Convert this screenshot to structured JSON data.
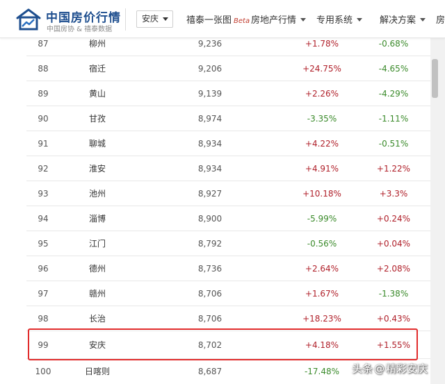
{
  "header": {
    "brand_title": "中国房价行情",
    "brand_subtitle": "中国房协 & 禧泰数据",
    "city_select": "安庆",
    "nav": [
      {
        "label": "禧泰一张图",
        "badge": "Beta"
      },
      {
        "label": "房地产行情"
      },
      {
        "label": "专用系统"
      },
      {
        "label": "解决方案"
      },
      {
        "label": "房"
      }
    ]
  },
  "table": {
    "rows": [
      {
        "rank": "87",
        "city": "柳州",
        "price": "9,236",
        "change1": "+1.78%",
        "change2": "-0.68%"
      },
      {
        "rank": "88",
        "city": "宿迁",
        "price": "9,206",
        "change1": "+24.75%",
        "change2": "-4.65%"
      },
      {
        "rank": "89",
        "city": "黄山",
        "price": "9,139",
        "change1": "+2.26%",
        "change2": "-4.29%"
      },
      {
        "rank": "90",
        "city": "甘孜",
        "price": "8,974",
        "change1": "-3.35%",
        "change2": "-1.11%"
      },
      {
        "rank": "91",
        "city": "聊城",
        "price": "8,934",
        "change1": "+4.22%",
        "change2": "-0.51%"
      },
      {
        "rank": "92",
        "city": "淮安",
        "price": "8,934",
        "change1": "+4.91%",
        "change2": "+1.22%"
      },
      {
        "rank": "93",
        "city": "池州",
        "price": "8,927",
        "change1": "+10.18%",
        "change2": "+3.3%"
      },
      {
        "rank": "94",
        "city": "淄博",
        "price": "8,900",
        "change1": "-5.99%",
        "change2": "+0.24%"
      },
      {
        "rank": "95",
        "city": "江门",
        "price": "8,792",
        "change1": "-0.56%",
        "change2": "+0.04%"
      },
      {
        "rank": "96",
        "city": "德州",
        "price": "8,736",
        "change1": "+2.64%",
        "change2": "+2.08%"
      },
      {
        "rank": "97",
        "city": "赣州",
        "price": "8,706",
        "change1": "+1.67%",
        "change2": "-1.38%"
      },
      {
        "rank": "98",
        "city": "长治",
        "price": "8,706",
        "change1": "+18.23%",
        "change2": "+0.43%"
      },
      {
        "rank": "99",
        "city": "安庆",
        "price": "8,702",
        "change1": "+4.18%",
        "change2": "+1.55%"
      },
      {
        "rank": "100",
        "city": "日喀则",
        "price": "8,687",
        "change1": "-17.48%",
        "change2": ""
      }
    ],
    "highlighted_rank": "99"
  },
  "watermark": {
    "prefix": "头条",
    "at": "@",
    "name": "精彩安庆"
  },
  "colors": {
    "brand": "#1f4f8f",
    "up": "#b0202a",
    "down": "#3a8a2a",
    "highlight": "#e12b2b"
  }
}
